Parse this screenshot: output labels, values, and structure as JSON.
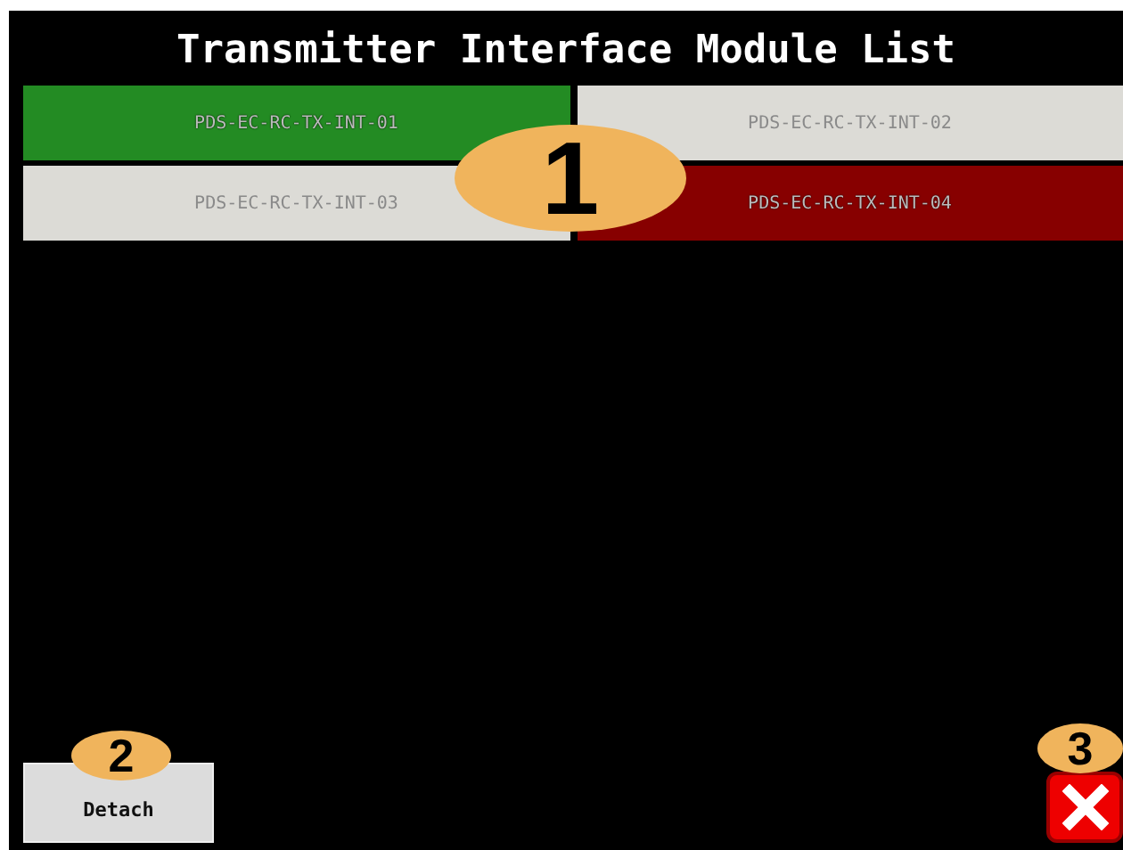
{
  "title": "Transmitter Interface Module List",
  "modules": [
    {
      "label": "PDS-EC-RC-TX-INT-01",
      "color": "#238b23"
    },
    {
      "label": "PDS-EC-RC-TX-INT-02",
      "color": "#dcdbd6"
    },
    {
      "label": "PDS-EC-RC-TX-INT-03",
      "color": "#dcdbd6"
    },
    {
      "label": "PDS-EC-RC-TX-INT-04",
      "color": "#870000"
    }
  ],
  "detach_button": {
    "label": "Detach"
  },
  "callouts": [
    "1",
    "2",
    "3"
  ]
}
